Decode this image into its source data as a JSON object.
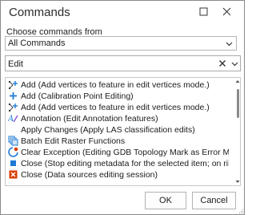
{
  "dialog": {
    "title": "Commands",
    "choose_label": "Choose commands from",
    "source_select": {
      "value": "All Commands"
    },
    "search": {
      "value": "Edit"
    },
    "items": [
      {
        "label": "Add (Add vertices to feature in edit vertices mode.)",
        "icon": "add-vertex-icon"
      },
      {
        "label": "Add (Calibration Point Editing)",
        "icon": "add-plus-icon"
      },
      {
        "label": "Add (Add vertices to feature in edit vertices mode.)",
        "icon": "add-vertex-icon"
      },
      {
        "label": "Annotation (Edit Annotation features)",
        "icon": "annotation-icon"
      },
      {
        "label": "Apply Changes (Apply LAS classification edits)",
        "icon": ""
      },
      {
        "label": "Batch Edit Raster Functions",
        "icon": "batch-raster-icon"
      },
      {
        "label": "Clear Exception (Editing GDB Topology Mark as Error Met...",
        "icon": "clear-exception-icon"
      },
      {
        "label": "Close (Stop editing metadata for the selected item; on rib...",
        "icon": "close-metadata-icon"
      },
      {
        "label": "Close (Data sources editing session)",
        "icon": "close-red-icon"
      }
    ],
    "ok_label": "OK",
    "cancel_label": "Cancel",
    "colors": {
      "accent_blue": "#1e7bd6",
      "close_red": "#d83b01",
      "annotation_purple": "#8a4fd0"
    }
  }
}
